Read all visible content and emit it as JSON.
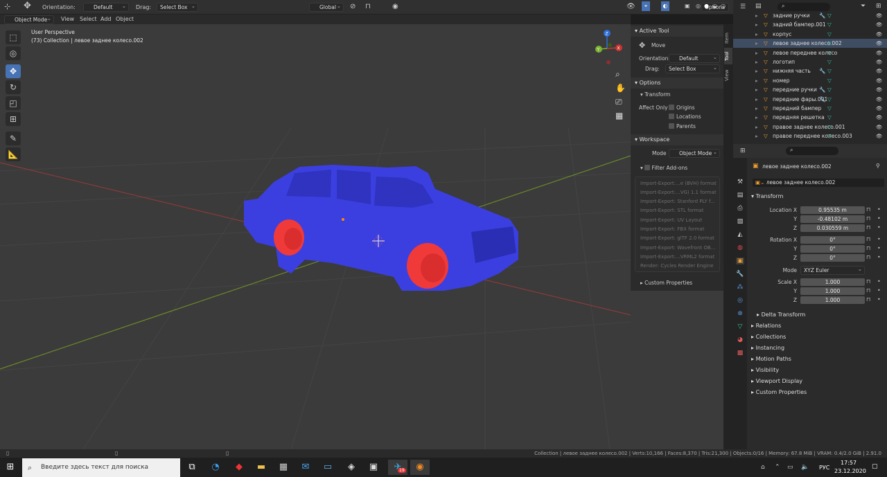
{
  "header": {
    "orientation_label": "Orientation:",
    "orientation_value": "Default",
    "drag_label": "Drag:",
    "drag_value": "Select Box",
    "transform_space": "Global",
    "options_label": "Options"
  },
  "menubar": {
    "mode": "Object Mode",
    "items": [
      "View",
      "Select",
      "Add",
      "Object"
    ]
  },
  "viewport": {
    "perspective": "User Perspective",
    "collection_info": "(73) Collection | левое заднее колесо.002",
    "car_color": "#3b3fe0",
    "wheel_color": "#f03a3a"
  },
  "gizmo": {
    "x": "X",
    "y": "Y",
    "z": "Z"
  },
  "npanel": {
    "tabs": [
      "Item",
      "Tool",
      "View"
    ],
    "active_tool": "Active Tool",
    "tool_name": "Move",
    "orientation_label": "Orientation",
    "orientation_value": "Default",
    "drag_label": "Drag:",
    "drag_value": "Select Box",
    "options": "Options",
    "transform": "Transform",
    "affect_only": "Affect Only",
    "origins": "Origins",
    "locations": "Locations",
    "parents": "Parents",
    "workspace": "Workspace",
    "mode_label": "Mode",
    "mode_value": "Object Mode",
    "filter_addons": "Filter Add-ons",
    "addons": [
      "Import-Export:...e (BVH) format",
      "Import-Export:...VG) 1.1 format",
      "Import-Export: Stanford PLY f...",
      "Import-Export: STL format",
      "Import-Export: UV Layout",
      "Import-Export: FBX format",
      "Import-Export: glTF 2.0 format",
      "Import-Export: Wavefront OB...",
      "Import-Export:...VRML2 format",
      "Render: Cycles Render Engine"
    ],
    "custom_properties": "Custom Properties"
  },
  "outliner": {
    "rows": [
      {
        "label": "задние ручки",
        "modifier": true,
        "sel": false
      },
      {
        "label": "задний бампер.001",
        "modifier": false,
        "sel": false
      },
      {
        "label": "корпус",
        "modifier": false,
        "sel": false
      },
      {
        "label": "левое заднее колесо.002",
        "modifier": false,
        "sel": true
      },
      {
        "label": "левое переднее колесо",
        "modifier": false,
        "sel": false
      },
      {
        "label": "логотип",
        "modifier": false,
        "sel": false
      },
      {
        "label": "нижняя часть",
        "modifier": true,
        "sel": false
      },
      {
        "label": "номер",
        "modifier": false,
        "sel": false
      },
      {
        "label": "передние ручки",
        "modifier": true,
        "sel": false
      },
      {
        "label": "передние фары.001",
        "modifier": true,
        "sel": false
      },
      {
        "label": "передний бампер",
        "modifier": false,
        "sel": false
      },
      {
        "label": "передняя решетка",
        "modifier": false,
        "sel": false
      },
      {
        "label": "правое заднее колесо.001",
        "modifier": false,
        "sel": false
      },
      {
        "label": "правое переднее колесо.003",
        "modifier": false,
        "sel": false
      }
    ]
  },
  "properties": {
    "object_name": "левое заднее колесо.002",
    "object_field": "левое заднее колесо.002",
    "transform": "Transform",
    "location_x_label": "Location X",
    "y_label": "Y",
    "z_label": "Z",
    "location": [
      "0.95535 m",
      "-0.48102 m",
      "0.030559 m"
    ],
    "rotation_x_label": "Rotation X",
    "rotation": [
      "0°",
      "0°",
      "0°"
    ],
    "mode_label": "Mode",
    "mode_value": "XYZ Euler",
    "scale_x_label": "Scale X",
    "scale": [
      "1.000",
      "1.000",
      "1.000"
    ],
    "delta_transform": "Delta Transform",
    "sections": [
      "Relations",
      "Collections",
      "Instancing",
      "Motion Paths",
      "Visibility",
      "Viewport Display",
      "Custom Properties"
    ]
  },
  "statusbar": {
    "text": "Collection | левое заднее колесо.002 | Verts:10,166 | Faces:8,370 | Tris:21,300 | Objects:0/16 | Memory: 67.8 MiB | VRAM: 0.4/2.0 GiB | 2.91.0"
  },
  "taskbar": {
    "search_placeholder": "Введите здесь текст для поиска",
    "lang": "РУС",
    "time": "17:57",
    "date": "23.12.2020",
    "badge": "19"
  }
}
